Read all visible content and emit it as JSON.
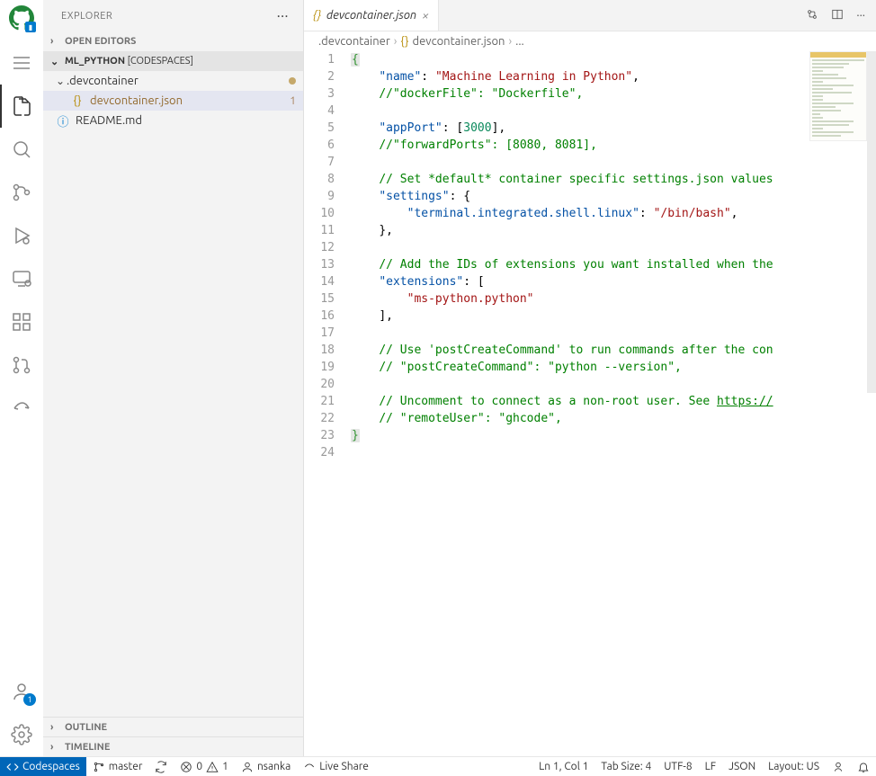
{
  "sidebar": {
    "title": "EXPLORER",
    "sections": {
      "open_editors": "OPEN EDITORS",
      "outline": "OUTLINE",
      "timeline": "TIMELINE"
    },
    "project": {
      "name": "ML_PYTHON",
      "suffix": "[CODESPACES]"
    },
    "tree": {
      "folder_devcontainer": ".devcontainer",
      "file_devcontainer_json": "devcontainer.json",
      "file_devcontainer_json_badge": "1",
      "file_readme": "README.md"
    }
  },
  "tab": {
    "title": "devcontainer.json"
  },
  "breadcrumb": {
    "p1": ".devcontainer",
    "p2": "devcontainer.json",
    "p3": "..."
  },
  "code": {
    "lines": [
      1,
      2,
      3,
      4,
      5,
      6,
      7,
      8,
      9,
      10,
      11,
      12,
      13,
      14,
      15,
      16,
      17,
      18,
      19,
      20,
      21,
      22,
      23,
      24
    ],
    "l2_key": "\"name\"",
    "l2_val": "\"Machine Learning in Python\"",
    "l3": "//\"dockerFile\": \"Dockerfile\",",
    "l5_key": "\"appPort\"",
    "l5_num": "3000",
    "l6": "//\"forwardPorts\": [8080, 8081],",
    "l8": "// Set *default* container specific settings.json values",
    "l9_key": "\"settings\"",
    "l10_key": "\"terminal.integrated.shell.linux\"",
    "l10_val": "\"/bin/bash\"",
    "l13": "// Add the IDs of extensions you want installed when the",
    "l14_key": "\"extensions\"",
    "l15_val": "\"ms-python.python\"",
    "l18": "// Use 'postCreateCommand' to run commands after the con",
    "l19": "// \"postCreateCommand\": \"python --version\",",
    "l21_a": "// Uncomment to connect as a non-root user. See ",
    "l21_b": "https://",
    "l22": "// \"remoteUser\": \"ghcode\","
  },
  "status": {
    "codespaces": "Codespaces",
    "branch": "master",
    "errors": "0",
    "warnings": "1",
    "user": "nsanka",
    "liveshare": "Live Share",
    "lncol": "Ln 1, Col 1",
    "tabsize": "Tab Size: 4",
    "encoding": "UTF-8",
    "eol": "LF",
    "lang": "JSON",
    "layout": "Layout: US"
  },
  "activity_badge": "1"
}
